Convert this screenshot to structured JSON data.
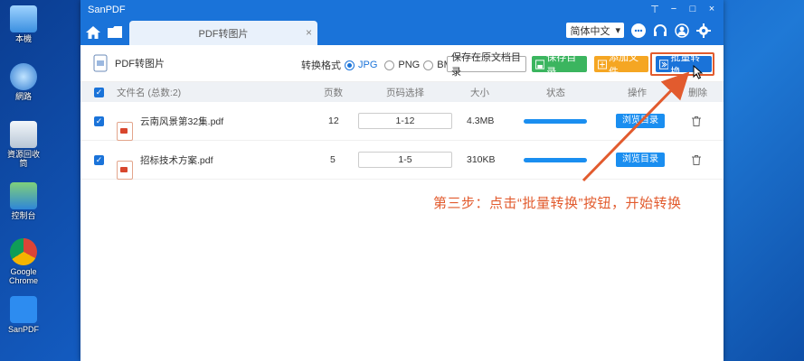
{
  "desktop": {
    "icons": [
      {
        "label": "本機"
      },
      {
        "label": "網路"
      },
      {
        "label": "資源回收筒"
      },
      {
        "label": "控制台"
      },
      {
        "label": "Google Chrome"
      },
      {
        "label": "SanPDF"
      }
    ]
  },
  "window": {
    "title": "SanPDF",
    "tab_label": "PDF转图片",
    "tab_close": "×",
    "language": "简体中文",
    "controls": [
      "⊤",
      "−",
      "□",
      "×"
    ]
  },
  "toolbar": {
    "tool_title": "PDF转图片",
    "format_label": "转换格式",
    "formats": [
      {
        "label": "JPG",
        "selected": true
      },
      {
        "label": "PNG",
        "selected": false
      },
      {
        "label": "BMP",
        "selected": false
      }
    ],
    "keep_original_dir": "保存在原文档目录",
    "save_dir": "保存目录",
    "add_file": "添加文件",
    "batch_convert": "批量转换"
  },
  "table": {
    "headers": {
      "filename": "文件名 (总数:2)",
      "pages": "页数",
      "page_select": "页码选择",
      "size": "大小",
      "status": "状态",
      "action": "操作",
      "delete": "删除"
    },
    "rows": [
      {
        "name": "云南风景第32集.pdf",
        "pages": "12",
        "range": "1-12",
        "size": "4.3MB",
        "progress": 1.0,
        "action": "浏览目录"
      },
      {
        "name": "招标技术方案.pdf",
        "pages": "5",
        "range": "1-5",
        "size": "310KB",
        "progress": 1.0,
        "action": "浏览目录"
      }
    ]
  },
  "annotation": "第三步：点击“批量转换”按钮，开始转换",
  "colors": {
    "accent": "#1a73d9",
    "save_green": "#3bb55f",
    "add_orange": "#f5a623",
    "annotation_red": "#e25b2e"
  }
}
